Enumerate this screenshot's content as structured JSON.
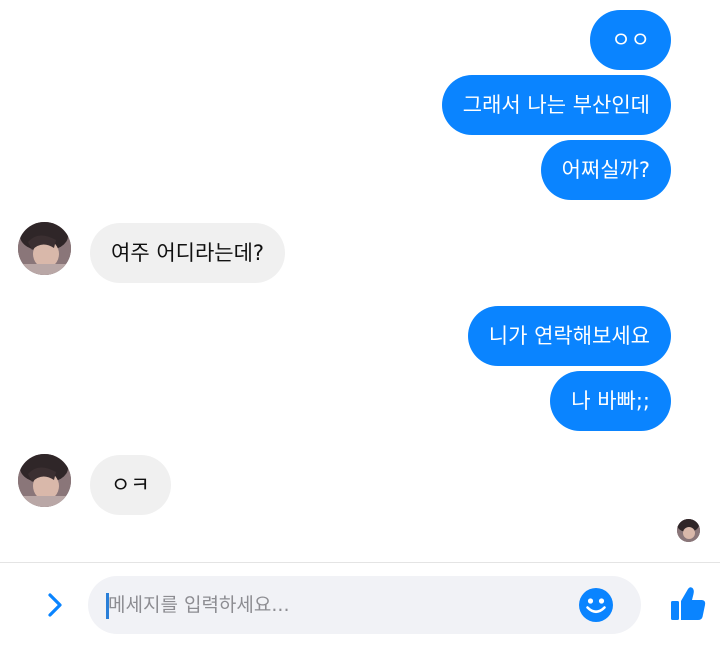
{
  "messages": [
    {
      "side": "sent",
      "text": "ㅇㅇ"
    },
    {
      "side": "sent",
      "text": "그래서 나는 부산인데"
    },
    {
      "side": "sent",
      "text": "어쩌실까?"
    },
    {
      "side": "received",
      "text": "여주 어디라는데?"
    },
    {
      "side": "sent",
      "text": "니가 연락해보세요"
    },
    {
      "side": "sent",
      "text": "나 바빠;;"
    },
    {
      "side": "received",
      "text": "ㅇㅋ"
    }
  ],
  "composer": {
    "placeholder": "메세지를 입력하세요..."
  },
  "colors": {
    "sent_bubble": "#0a84ff",
    "received_bubble": "#f0f0f0",
    "accent": "#0a84ff"
  },
  "icons": {
    "expand": "chevron-right-icon",
    "emoji": "smiley-icon",
    "like": "thumbs-up-icon"
  }
}
